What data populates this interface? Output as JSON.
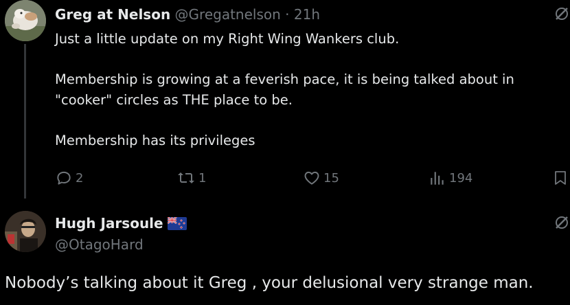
{
  "tweet1": {
    "author_name": "Greg at Nelson",
    "handle": "@Gregatnelson",
    "separator": "·",
    "time": "21h",
    "lines": [
      "Just a little update on my Right Wing Wankers club.",
      "Membership is growing at a feverish pace, it is being talked about in",
      "\"cooker\" circles as THE place to be.",
      "Membership has its privileges"
    ],
    "actions": {
      "replies": "2",
      "reposts": "1",
      "likes": "15",
      "views": "194"
    }
  },
  "tweet2": {
    "author_name": "Hugh Jarsoule",
    "flag": "new-zealand-flag",
    "handle": "@OtagoHard",
    "text": "Nobody’s talking about it Greg , your delusional very strange man."
  },
  "colors": {
    "background": "#000000",
    "primary_text": "#e7e9ea",
    "secondary_text": "#71767b",
    "thread_line": "#333639"
  }
}
